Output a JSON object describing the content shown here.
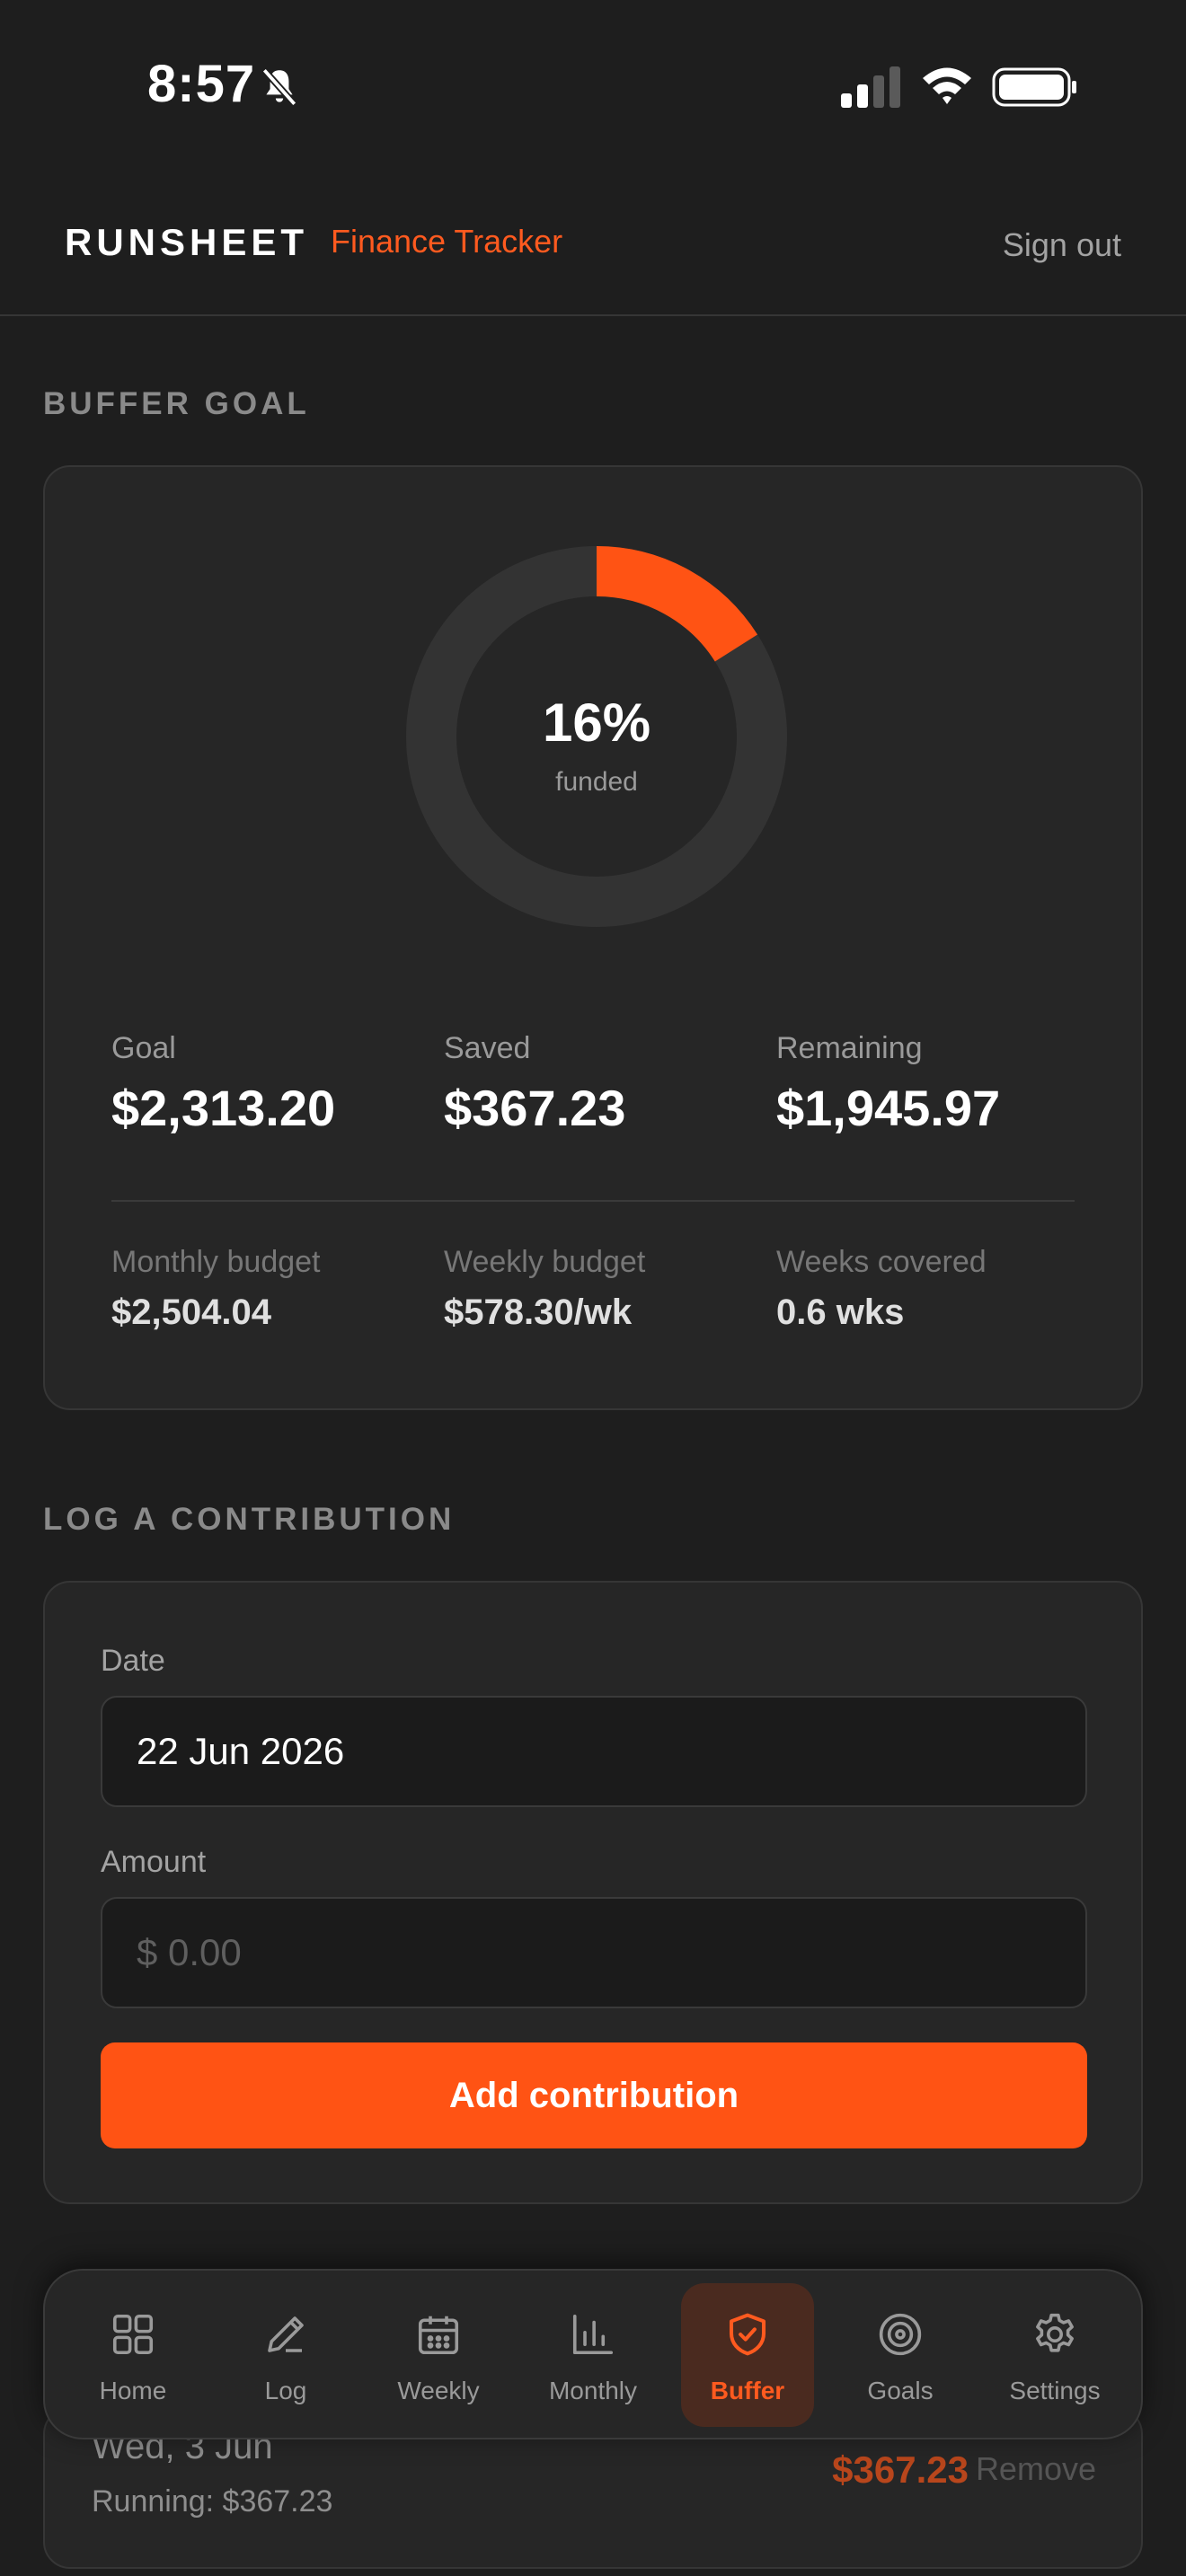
{
  "status_bar": {
    "time": "8:57",
    "icons": [
      "bell-slash-icon",
      "signal-icon",
      "wifi-icon",
      "battery-icon"
    ]
  },
  "header": {
    "brand": "RUNSHEET",
    "subtitle": "Finance Tracker",
    "sign_out": "Sign out"
  },
  "buffer_goal": {
    "section_title": "BUFFER GOAL",
    "percent_label": "16%",
    "funded_fraction": 0.16,
    "funded_label": "funded",
    "stats": [
      {
        "label": "Goal",
        "value": "$2,313.20"
      },
      {
        "label": "Saved",
        "value": "$367.23"
      },
      {
        "label": "Remaining",
        "value": "$1,945.97"
      }
    ],
    "secondary_stats": [
      {
        "label": "Monthly budget",
        "value": "$2,504.04"
      },
      {
        "label": "Weekly budget",
        "value": "$578.30/wk"
      },
      {
        "label": "Weeks covered",
        "value": "0.6 wks"
      }
    ]
  },
  "contribution_form": {
    "section_title": "LOG A CONTRIBUTION",
    "date_label": "Date",
    "date_value": "22 Jun 2026",
    "amount_label": "Amount",
    "amount_placeholder": "$ 0.00",
    "submit_label": "Add contribution"
  },
  "history": [
    {
      "date": "Wed, 3 Jun",
      "running": "Running: $367.23",
      "amount": "$367.23",
      "remove": "Remove"
    }
  ],
  "bottom_nav": {
    "items": [
      {
        "label": "Home",
        "icon": "grid-icon"
      },
      {
        "label": "Log",
        "icon": "pencil-icon"
      },
      {
        "label": "Weekly",
        "icon": "calendar-icon"
      },
      {
        "label": "Monthly",
        "icon": "bar-chart-icon"
      },
      {
        "label": "Buffer",
        "icon": "shield-check-icon"
      },
      {
        "label": "Goals",
        "icon": "target-icon"
      },
      {
        "label": "Settings",
        "icon": "gear-icon"
      }
    ],
    "active": "Buffer"
  },
  "colors": {
    "accent": "#ff5314",
    "background": "#1e1e1e",
    "card": "#262626",
    "donut_track": "#333333"
  }
}
